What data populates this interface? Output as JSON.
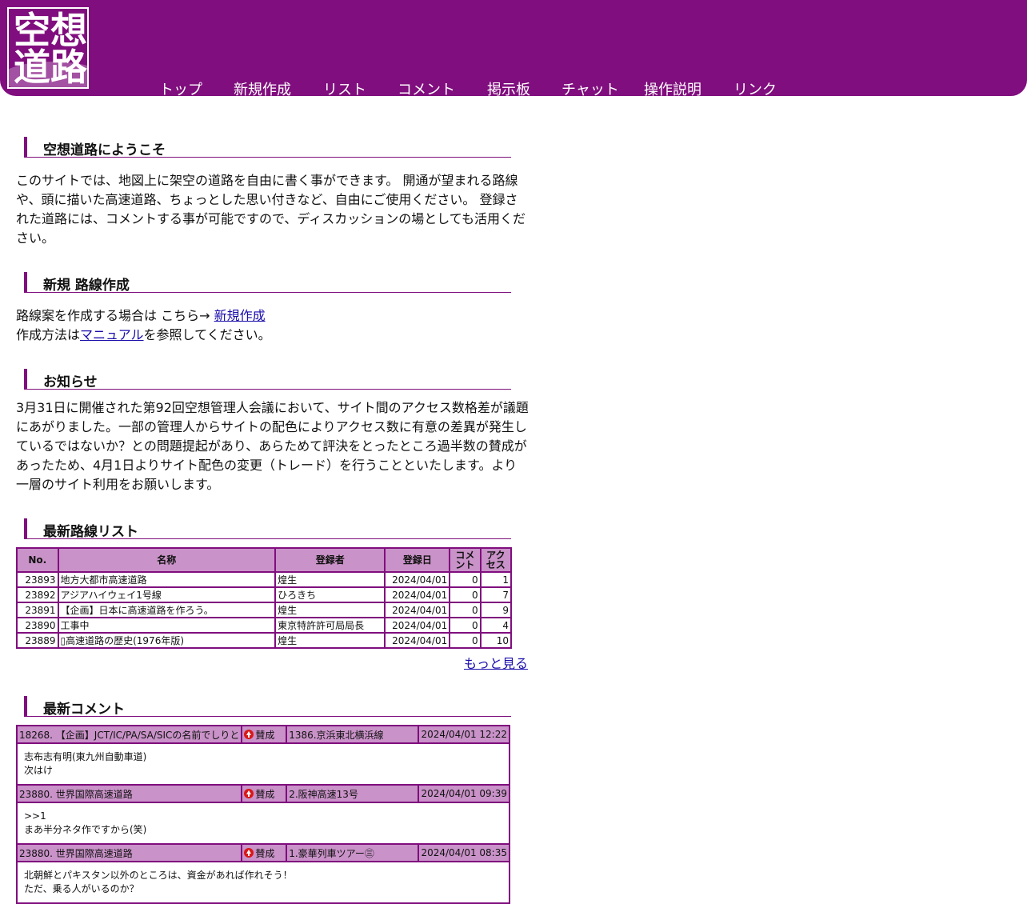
{
  "logo": {
    "chars": [
      "空",
      "想",
      "道",
      "路"
    ]
  },
  "nav": [
    {
      "label": "トップ"
    },
    {
      "label": "新規作成"
    },
    {
      "label": "リスト"
    },
    {
      "label": "コメント"
    },
    {
      "label": "掲示板"
    },
    {
      "label": "チャット"
    },
    {
      "label": "操作説明"
    },
    {
      "label": "リンク"
    }
  ],
  "welcome": {
    "title": "空想道路にようこそ",
    "text": "このサイトでは、地図上に架空の道路を自由に書く事ができます。 開通が望まれる路線や、頭に描いた高速道路、ちょっとした思い付きなど、自由にご使用ください。 登録された道路には、コメントする事が可能ですので、ディスカッションの場としても活用ください。"
  },
  "create": {
    "title": "新規 路線作成",
    "line1_prefix": "路線案を作成する場合は こちら→ ",
    "line1_link": "新規作成",
    "line2_prefix": "作成方法は",
    "line2_link": "マニュアル",
    "line2_suffix": "を参照してください。"
  },
  "notice": {
    "title": "お知らせ",
    "text": "3月31日に開催された第92回空想管理人会議において、サイト間のアクセス数格差が議題にあがりました。一部の管理人からサイトの配色によりアクセス数に有意の差異が発生しているではないか？との問題提起があり、あらためて評決をとったところ過半数の賛成があったため、4月1日よりサイト配色の変更（トレード）を行うことといたします。より一層のサイト利用をお願いします。"
  },
  "routes": {
    "title": "最新路線リスト",
    "headers": [
      "No.",
      "名称",
      "登録者",
      "登録日",
      "コメント",
      "アクセス"
    ],
    "rows": [
      {
        "no": "23893",
        "name": "地方大都市高速道路",
        "user": "煌生",
        "date": "2024/04/01",
        "comments": "0",
        "access": "1"
      },
      {
        "no": "23892",
        "name": "アジアハイウェイ1号線",
        "user": "ひろきち",
        "date": "2024/04/01",
        "comments": "0",
        "access": "7"
      },
      {
        "no": "23891",
        "name": "【企画】日本に高速道路を作ろう。",
        "user": "煌生",
        "date": "2024/04/01",
        "comments": "0",
        "access": "9"
      },
      {
        "no": "23890",
        "name": "工事中",
        "user": "東京特許許可局局長",
        "date": "2024/04/01",
        "comments": "0",
        "access": "4"
      },
      {
        "no": "23889",
        "name": "▯高速道路の歴史(1976年版)",
        "user": "煌生",
        "date": "2024/04/01",
        "comments": "0",
        "access": "10"
      }
    ],
    "more": "もっと見る"
  },
  "comments": {
    "title": "最新コメント",
    "items": [
      {
        "route": "18268. 【企画】JCT/IC/PA/SA/SICの名前でしりと",
        "vote": "賛成",
        "user": "1386.京浜東北横浜線",
        "date": "2024/04/01 12:22",
        "line1": "志布志有明(東九州自動車道)",
        "line2": "次はけ"
      },
      {
        "route": "23880. 世界国際高速道路",
        "vote": "賛成",
        "user": "2.阪神高速13号",
        "date": "2024/04/01 09:39",
        "line1": ">>1",
        "line2": "まあ半分ネタ作ですから(笑)"
      },
      {
        "route": "23880. 世界国際高速道路",
        "vote": "賛成",
        "user": "1.豪華列車ツアー㊂",
        "date": "2024/04/01 08:35",
        "line1": "北朝鮮とパキスタン以外のところは、資金があれば作れそう！",
        "line2": "ただ、乗る人がいるのか？"
      }
    ]
  },
  "colors": {
    "brand": "#800e7e",
    "header_cell": "#c992c8",
    "link": "#1a0dab",
    "vote_icon": "#d81818"
  },
  "icons": {
    "vote": "up-arrow-icon"
  }
}
